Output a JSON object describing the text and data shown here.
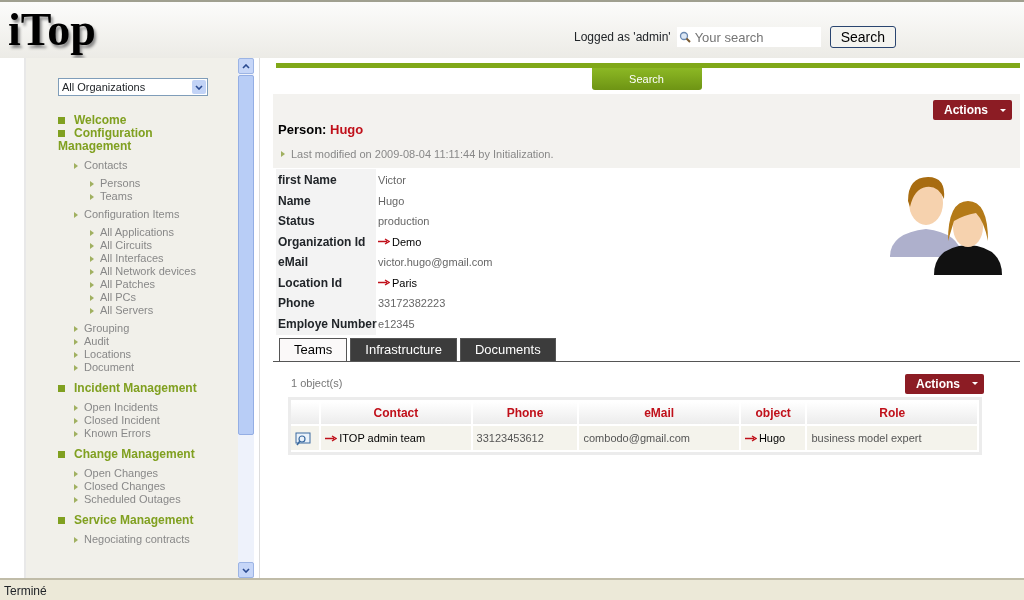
{
  "header": {
    "logo": "iTop",
    "logged_as": "Logged as 'admin'",
    "search_placeholder": "Your search",
    "search_button": "Search"
  },
  "sidebar": {
    "organization": "All Organizations",
    "menu": [
      {
        "label": "Welcome"
      },
      {
        "label": "Configuration Management",
        "children": [
          {
            "label": "Contacts",
            "children": [
              {
                "label": "Persons"
              },
              {
                "label": "Teams"
              }
            ]
          },
          {
            "label": "Configuration Items",
            "children": [
              {
                "label": "All Applications"
              },
              {
                "label": "All Circuits"
              },
              {
                "label": "All Interfaces"
              },
              {
                "label": "All Network devices"
              },
              {
                "label": "All Patches"
              },
              {
                "label": "All PCs"
              },
              {
                "label": "All Servers"
              }
            ]
          },
          {
            "label": "Grouping"
          },
          {
            "label": "Audit"
          },
          {
            "label": "Locations"
          },
          {
            "label": "Document"
          }
        ]
      },
      {
        "label": "Incident Management",
        "children": [
          {
            "label": "Open Incidents"
          },
          {
            "label": "Closed Incident"
          },
          {
            "label": "Known Errors"
          }
        ]
      },
      {
        "label": "Change Management",
        "children": [
          {
            "label": "Open Changes"
          },
          {
            "label": "Closed Changes"
          },
          {
            "label": "Scheduled Outages"
          }
        ]
      },
      {
        "label": "Service Management",
        "children": [
          {
            "label": "Negociating contracts"
          }
        ]
      }
    ]
  },
  "search_tab": "Search",
  "details": {
    "class_label": "Person:",
    "name": "Hugo",
    "actions": "Actions",
    "last_modified": "Last modified on 2009-08-04 11:11:44 by Initialization.",
    "fields": [
      {
        "label": "first Name",
        "value": "Victor",
        "link": false
      },
      {
        "label": "Name",
        "value": "Hugo",
        "link": false
      },
      {
        "label": "Status",
        "value": "production",
        "link": false
      },
      {
        "label": "Organization Id",
        "value": "Demo",
        "link": true
      },
      {
        "label": "eMail",
        "value": "victor.hugo@gmail.com",
        "link": false
      },
      {
        "label": "Location Id",
        "value": "Paris",
        "link": true
      },
      {
        "label": "Phone",
        "value": "33172382223",
        "link": false
      },
      {
        "label": "Employe Number",
        "value": "e12345",
        "link": false
      }
    ]
  },
  "tabs": [
    {
      "label": "Teams",
      "selected": true
    },
    {
      "label": "Infrastructure",
      "selected": false
    },
    {
      "label": "Documents",
      "selected": false
    }
  ],
  "list": {
    "count": "1 object(s)",
    "actions": "Actions",
    "columns": [
      "Contact",
      "Phone",
      "eMail",
      "object",
      "Role"
    ],
    "rows": [
      [
        {
          "text": "ITOP admin team",
          "link": true
        },
        {
          "text": "33123453612",
          "link": false
        },
        {
          "text": "combodo@gmail.com",
          "link": false
        },
        {
          "text": "Hugo",
          "link": true
        },
        {
          "text": "business model expert",
          "link": false
        }
      ]
    ]
  },
  "status_bar": "Terminé"
}
